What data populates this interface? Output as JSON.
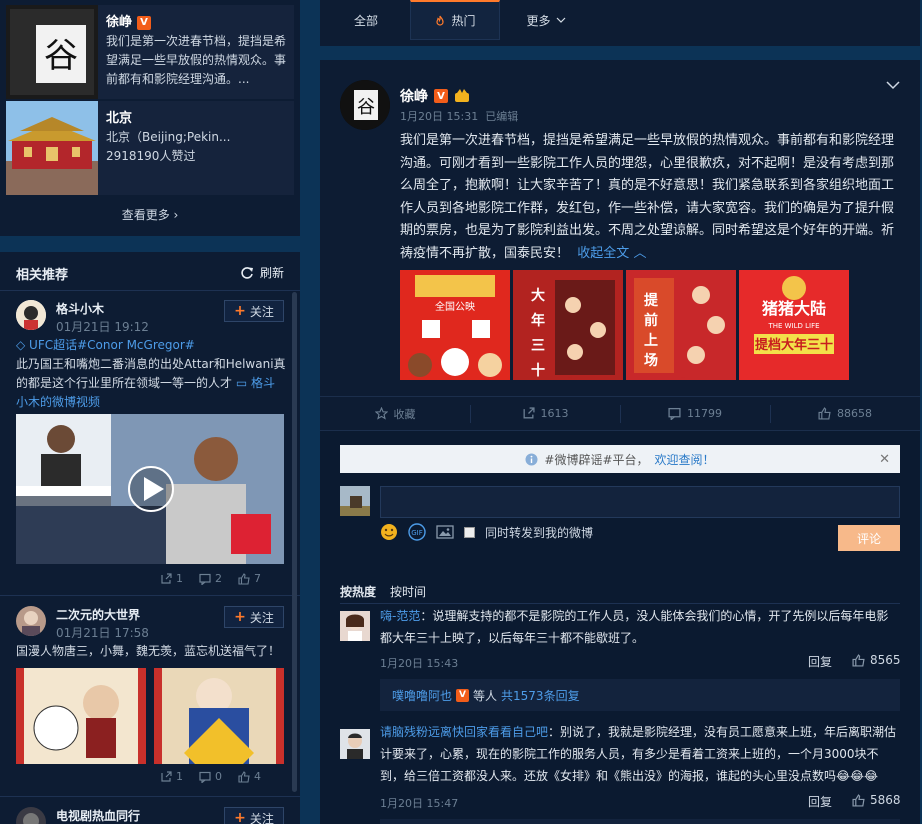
{
  "left_top": {
    "cards": [
      {
        "name": "徐峥",
        "text": "我们是第一次进春节档，提挡是希望满足一些早放假的热情观众。事前都有和影院经理沟通。..."
      },
      {
        "name": "北京",
        "line1": "北京（Beijing;Pekin...",
        "line2": "2918190人赞过"
      }
    ],
    "see_more": "查看更多 ›"
  },
  "recommend": {
    "title": "相关推荐",
    "refresh": "刷新",
    "follow": "关注",
    "items": [
      {
        "name": "格斗小木",
        "time": "01月21日 19:12",
        "tag": "UFC超话#Conor McGregor#",
        "text": "此乃国王和嘴炮二番消息的出处Attar和Helwani真的都是这个行业里所在领域一等一的人才",
        "video_link": "格斗小木的微博视频",
        "share": "1",
        "comments": "2",
        "likes": "7"
      },
      {
        "name": "二次元的大世界",
        "time": "01月21日 17:58",
        "text": "国漫人物唐三，小舞，魏无羡，蓝忘机送福气了！",
        "share": "1",
        "comments": "0",
        "likes": "4"
      },
      {
        "name": "电视剧热血同行"
      }
    ]
  },
  "tabs": {
    "all": "全部",
    "hot": "热门",
    "more": "更多"
  },
  "post": {
    "name": "徐峥",
    "time": "1月20日 15:31",
    "edited": "已编辑",
    "text": "我们是第一次进春节档，提挡是希望满足一些早放假的热情观众。事前都有和影院经理沟通。可刚才看到一些影院工作人员的埋怨，心里很歉疚，对不起啊！是没有考虑到那么周全了，抱歉啊！让大家辛苦了！真的是不好意思！我们紧急联系到各家组织地面工作人员到各地影院工作群，发红包，作一些补偿，请大家宽容。我们的确是为了提升假期的票房，也是为了影院利益出发。不周之处望谅解。同时希望这是个好年的开端。祈祷疫情不再扩散，国泰民安！",
    "collapse": "收起全文",
    "posters": [
      "全国公映",
      "大年三十",
      "提前上场",
      "提档大年三十"
    ],
    "poster_extra": "THE WILD LIFE",
    "poster_title": "猪猪大陆",
    "actions": {
      "collect": "收藏",
      "share": "1613",
      "comment": "11799",
      "like": "88658"
    }
  },
  "comment_box": {
    "notice_prefix": "#微博辟谣#平台，",
    "notice_link": "欢迎查阅！",
    "forward": "同时转发到我的微博",
    "submit": "评论",
    "sort_hot": "按热度",
    "sort_time": "按时间"
  },
  "comments": [
    {
      "user": "嗨-范范",
      "text": "：说理解支持的都不是影院的工作人员，没人能体会我们的心情，开了先例以后每年电影都大年三十上映了，以后每年三十都不能歇班了。",
      "time": "1月20日 15:43",
      "reply": "回复",
      "likes": "8565",
      "sub_user": "噗噜噜阿也",
      "sub_mid": "等人",
      "sub_link": "共1573条回复"
    },
    {
      "user": "请脑残粉远离快回家看看自己吧",
      "text": "：别说了，我就是影院经理，没有员工愿意来上班，年后离职潮估计要来了，心累，现在的影院工作的服务人员，有多少是看着工资来上班的，一个月3000块不到，给三倍工资都没人来。还放《女排》和《熊出没》的海报，谁起的头心里没点数吗😂😂😂",
      "time": "1月20日 15:47",
      "reply": "回复",
      "likes": "5868"
    }
  ]
}
